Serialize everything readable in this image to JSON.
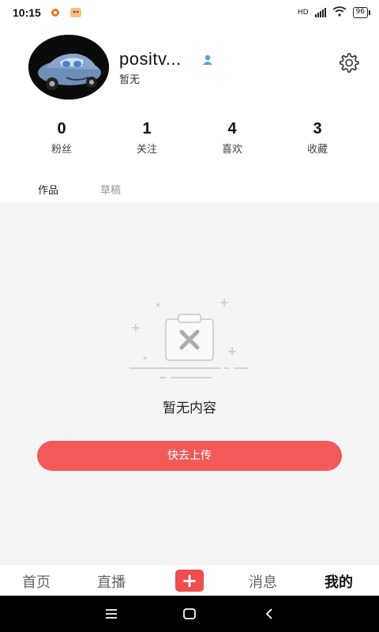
{
  "status_bar": {
    "time": "10:15",
    "network": "HD",
    "battery": "96"
  },
  "profile": {
    "username": "positv...",
    "bio": "暂无"
  },
  "stats": [
    {
      "value": "0",
      "label": "粉丝"
    },
    {
      "value": "1",
      "label": "关注"
    },
    {
      "value": "4",
      "label": "喜欢"
    },
    {
      "value": "3",
      "label": "收藏"
    }
  ],
  "tabs": [
    {
      "label": "作品",
      "active": true
    },
    {
      "label": "草稿",
      "active": false
    }
  ],
  "empty_state": {
    "message": "暂无内容",
    "button_label": "快去上传"
  },
  "bottom_nav": {
    "home": "首页",
    "live": "直播",
    "add": "+",
    "messages": "消息",
    "mine": "我的"
  },
  "colors": {
    "accent": "#f25a5a",
    "content_bg": "#f4f4f4"
  }
}
